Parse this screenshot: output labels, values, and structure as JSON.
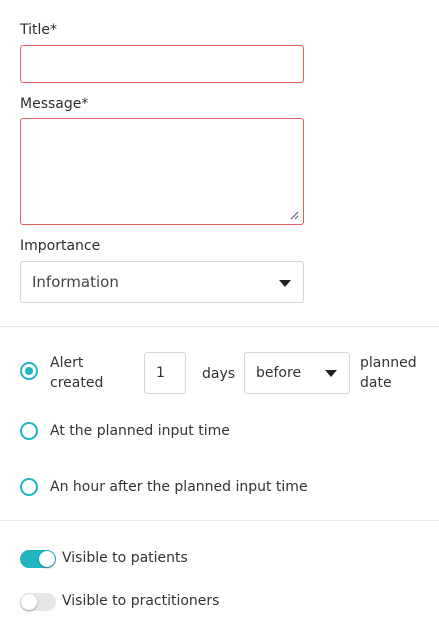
{
  "form": {
    "title_label": "Title*",
    "title_value": "",
    "message_label": "Message*",
    "message_value": "",
    "importance_label": "Importance",
    "importance_selected": "Information"
  },
  "schedule": {
    "option1": {
      "label_top": "Alert",
      "label_bottom": "created",
      "days_value": "1",
      "days_label": "days",
      "direction_selected": "before",
      "suffix_top": "planned",
      "suffix_bottom": "date"
    },
    "option2_label": "At the planned input time",
    "option3_label": "An hour after the planned input time"
  },
  "visibility": {
    "patients_label": "Visible to patients",
    "patients_on": true,
    "practitioners_label": "Visible to practitioners",
    "practitioners_on": false
  },
  "colors": {
    "accent": "#1fb6c1",
    "error_border": "#e06060"
  }
}
